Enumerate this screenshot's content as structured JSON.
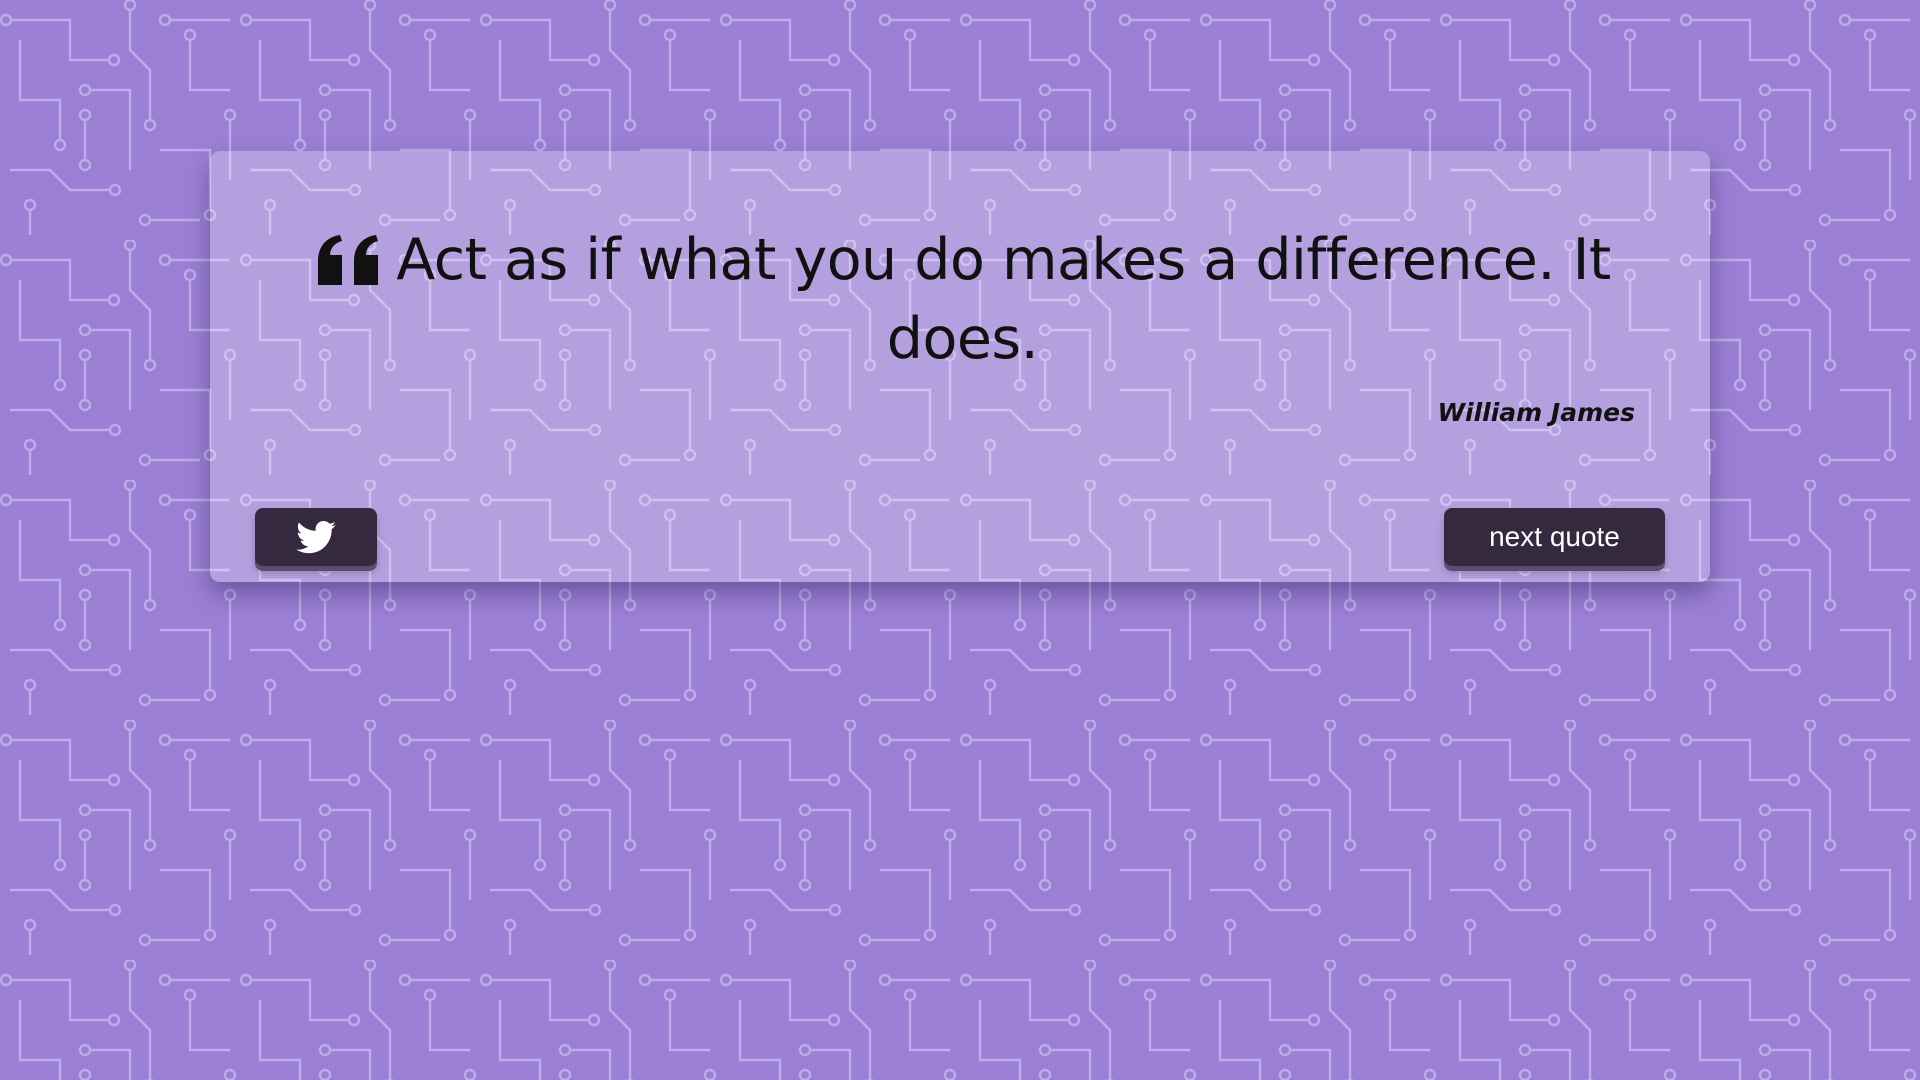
{
  "background": {
    "color": "#9b7fd4",
    "pattern": "circuit-board"
  },
  "quote": {
    "text": "Act as if what you do makes a difference. It does.",
    "author": "William James",
    "icon": "quote-left-icon"
  },
  "buttons": {
    "tweet": {
      "icon": "twitter-icon"
    },
    "next_label": "next quote"
  },
  "colors": {
    "button_bg": "#35293f",
    "text": "#111111",
    "card_bg": "rgba(255,255,255,0.26)"
  }
}
